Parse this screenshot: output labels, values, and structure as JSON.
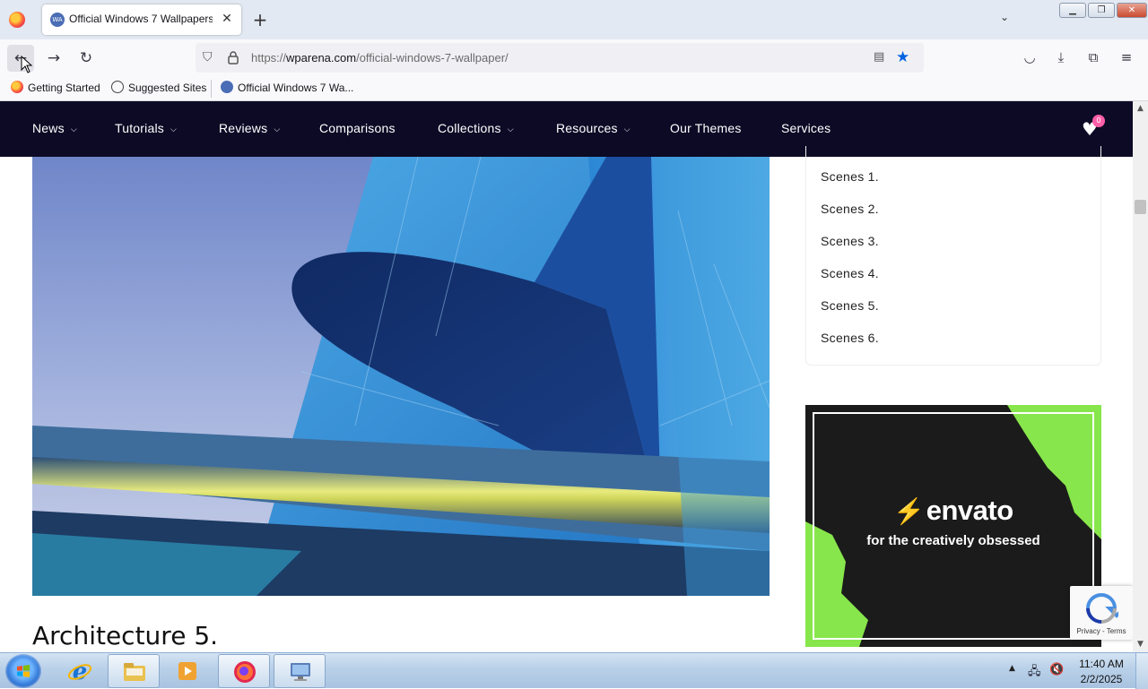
{
  "browser": {
    "tab": {
      "title": "Official Windows 7 Wallpapers",
      "favicon": "WA"
    },
    "url": {
      "domain": "wparena.com",
      "path": "/official-windows-7-wallpaper/",
      "scheme": "https://"
    },
    "bookmarks": [
      {
        "label": "Getting Started",
        "icon": "firefox-icon"
      },
      {
        "label": "Suggested Sites",
        "icon": "globe-icon"
      },
      {
        "label": "Official Windows 7 Wa...",
        "icon": "wparena-favicon"
      }
    ],
    "icons": {
      "back": "←",
      "forward": "→",
      "reload": "↻",
      "close_tab": "✕",
      "new_tab": "+",
      "tab_list": "⌄",
      "shield": "⛉",
      "reader": "▤",
      "star": "★",
      "pocket": "◡",
      "download": "⤓",
      "extensions": "⧉",
      "menu": "≡",
      "min": "▁",
      "max": "❐",
      "close": "✕"
    }
  },
  "site": {
    "menu": [
      {
        "label": "News",
        "dropdown": true
      },
      {
        "label": "Tutorials",
        "dropdown": true
      },
      {
        "label": "Reviews",
        "dropdown": true
      },
      {
        "label": "Comparisons",
        "dropdown": false
      },
      {
        "label": "Collections",
        "dropdown": true
      },
      {
        "label": "Resources",
        "dropdown": true
      },
      {
        "label": "Our Themes",
        "dropdown": false
      },
      {
        "label": "Services",
        "dropdown": false
      }
    ],
    "wishlist_count": "0",
    "toc": [
      "Scenes 1.",
      "Scenes 2.",
      "Scenes 3.",
      "Scenes 4.",
      "Scenes 5.",
      "Scenes 6."
    ],
    "article_heading": "Architecture 5.",
    "ad": {
      "brand": "envato",
      "tagline": "for the creatively obsessed",
      "accent": "#87e64b"
    },
    "recaptcha": {
      "links": "Privacy - Terms"
    }
  },
  "taskbar": {
    "time": "11:40 AM",
    "date": "2/2/2025"
  },
  "colors": {
    "site_nav_bg": "#0c0a25",
    "badge": "#ff5fa8",
    "star": "#0061e0"
  }
}
